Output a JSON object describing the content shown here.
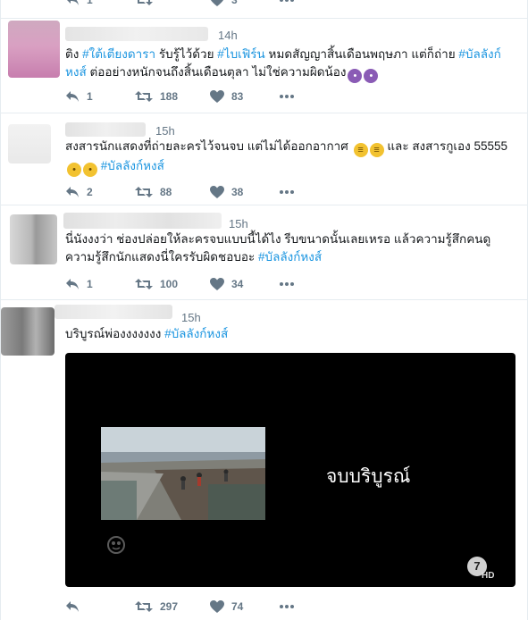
{
  "tweets": [
    {
      "time": "",
      "text": [],
      "stats": {
        "reply": "1",
        "retweet": "",
        "like": "3"
      }
    },
    {
      "time": "14h",
      "text": [
        [
          {
            "t": "ติง "
          },
          {
            "t": "#ใต้เตียงดารา",
            "tag": true
          },
          {
            "t": " รับรู้ไว้ด้วย "
          },
          {
            "t": "#ไบเฟิร์น",
            "tag": true
          },
          {
            "t": " หมดสัญญาสิ้นเดือนพฤษภา แต่ก็ถ่าย "
          },
          {
            "t": "#บัลลังก์",
            "tag": true
          }
        ],
        [
          {
            "t": "หงส์",
            "tag": true
          },
          {
            "t": " ต่ออย่างหนักจนถึงสิ้นเดือนตุลา ไม่ใช่ความผิดน้อง"
          },
          {
            "e": "devil"
          },
          {
            "e": "devil"
          }
        ]
      ],
      "stats": {
        "reply": "1",
        "retweet": "188",
        "like": "83"
      }
    },
    {
      "time": "15h",
      "text": [
        [
          {
            "t": "สงสารนักแสดงที่ถ่ายละครไว้จนจบ แต่ไม่ได้ออกอากาศ "
          },
          {
            "e": "grimace"
          },
          {
            "e": "grimace"
          },
          {
            "t": " และ สงสารกูเอง 55555"
          }
        ],
        [
          {
            "e": "cry"
          },
          {
            "e": "cry"
          },
          {
            "t": " "
          },
          {
            "t": "#บัลลังก์หงส์",
            "tag": true
          }
        ]
      ],
      "stats": {
        "reply": "2",
        "retweet": "88",
        "like": "38"
      }
    },
    {
      "time": "15h",
      "text": [
        [
          {
            "t": "นี่นังงงว่า ช่องปล่อยให้ละครจบแบบนี้ได้ไง รีบขนาดนั้นเลยเหรอ แล้วความรู้สึกคนดู"
          }
        ],
        [
          {
            "t": "ความรู้สึกนักแสดงนี่ใครรับผิดชอบอะ  "
          },
          {
            "t": "#บัลลังก์หงส์",
            "tag": true
          }
        ]
      ],
      "stats": {
        "reply": "1",
        "retweet": "100",
        "like": "34"
      }
    },
    {
      "time": "15h",
      "text": [
        [
          {
            "t": "บริบูรณ์พ่องงงงงงง "
          },
          {
            "t": "#บัลลังก์หงส์",
            "tag": true
          }
        ]
      ],
      "stats": {
        "reply": "",
        "retweet": "297",
        "like": "74"
      }
    }
  ],
  "media": {
    "caption": "จบบริบูรณ์",
    "hd_label": "HD",
    "logo_number": "7"
  },
  "colors": {
    "hashtag": "#1b95e0",
    "icon": "#657786",
    "border": "#e6ecf0"
  }
}
